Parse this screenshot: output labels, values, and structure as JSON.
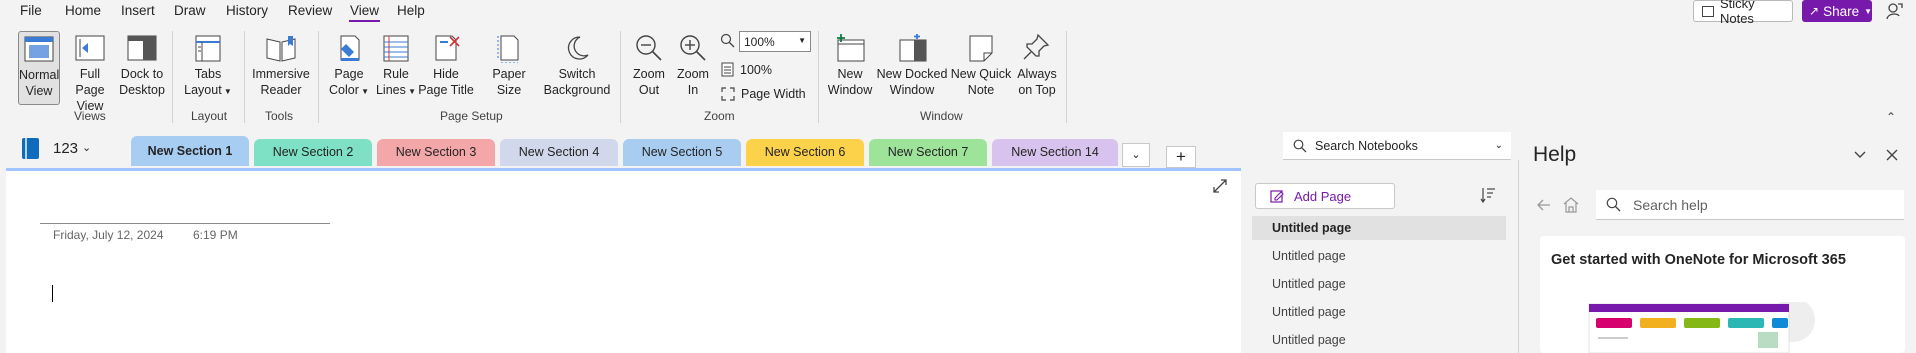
{
  "menu": {
    "items": [
      "File",
      "Home",
      "Insert",
      "Draw",
      "History",
      "Review",
      "View",
      "Help"
    ],
    "active": "View",
    "sticky_notes": "Sticky Notes",
    "share": "Share"
  },
  "ribbon": {
    "views": {
      "normal_view": [
        "Normal",
        "View"
      ],
      "full_page_view": [
        "Full Page",
        "View"
      ],
      "dock_to_desktop": [
        "Dock to",
        "Desktop"
      ],
      "label": "Views"
    },
    "layout": {
      "tabs_layout": [
        "Tabs",
        "Layout"
      ],
      "label": "Layout"
    },
    "tools": {
      "immersive_reader": [
        "Immersive",
        "Reader"
      ],
      "label": "Tools"
    },
    "page_setup": {
      "page_color": [
        "Page",
        "Color"
      ],
      "rule_lines": [
        "Rule",
        "Lines"
      ],
      "hide_page_title": [
        "Hide",
        "Page Title"
      ],
      "paper_size": [
        "Paper",
        "Size"
      ],
      "switch_background": [
        "Switch",
        "Background"
      ],
      "label": "Page Setup"
    },
    "zoom": {
      "zoom_out": [
        "Zoom",
        "Out"
      ],
      "zoom_in": [
        "Zoom",
        "In"
      ],
      "zoom_value": "100%",
      "hundred_percent": "100%",
      "page_width": "Page Width",
      "label": "Zoom"
    },
    "window": {
      "new_window": [
        "New",
        "Window"
      ],
      "new_docked_window": [
        "New Docked",
        "Window"
      ],
      "new_quick_note": [
        "New Quick",
        "Note"
      ],
      "always_on_top": [
        "Always",
        "on Top"
      ],
      "label": "Window"
    }
  },
  "notebook": {
    "name": "123",
    "sections": [
      {
        "name": "New Section 1",
        "color": "#a8cdf3",
        "active": true
      },
      {
        "name": "New Section 2",
        "color": "#7ee0c4"
      },
      {
        "name": "New Section 3",
        "color": "#f4a7a9"
      },
      {
        "name": "New Section 4",
        "color": "#d2d8ec"
      },
      {
        "name": "New Section 5",
        "color": "#a9cdf0"
      },
      {
        "name": "New Section 6",
        "color": "#fbd24a"
      },
      {
        "name": "New Section 7",
        "color": "#9ee39a"
      },
      {
        "name": "New Section 14",
        "color": "#d8c3ef"
      }
    ],
    "search_placeholder": "Search Notebooks"
  },
  "page": {
    "date": "Friday, July 12, 2024",
    "time": "6:19 PM"
  },
  "pages": {
    "add_page": "Add Page",
    "items": [
      "Untitled page",
      "Untitled page",
      "Untitled page",
      "Untitled page",
      "Untitled page"
    ]
  },
  "help": {
    "title": "Help",
    "search_placeholder": "Search help",
    "card_title": "Get started with OneNote for Microsoft 365"
  },
  "colors": {
    "accent": "#7719aa",
    "notebook": "#0f6cbd"
  }
}
